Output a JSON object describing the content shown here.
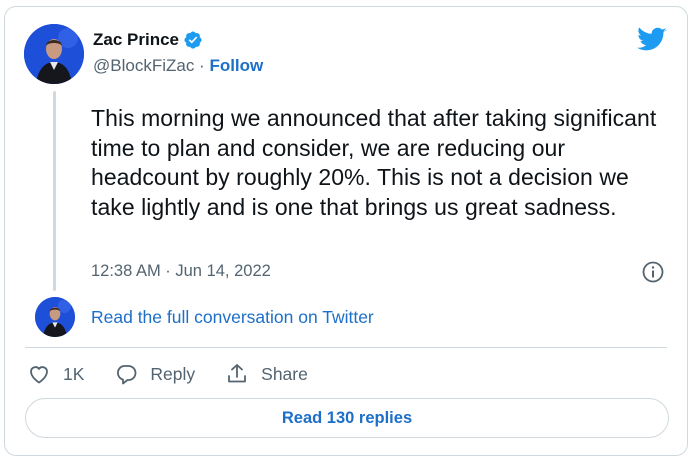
{
  "author": {
    "name": "Zac Prince",
    "handle": "@BlockFiZac",
    "separator": " · ",
    "follow_label": "Follow"
  },
  "tweet": {
    "text": "This morning we announced that after taking significant time to plan and consider, we are reducing our headcount by roughly 20%. This is not a decision we take lightly and is one that brings us great sadness.",
    "timestamp": "12:38 AM · Jun 14, 2022"
  },
  "conversation_link": "Read the full conversation on Twitter",
  "actions": {
    "like_count": "1K",
    "reply_label": "Reply",
    "share_label": "Share"
  },
  "replies_button": "Read 130 replies",
  "colors": {
    "accent": "#1d6fc9",
    "twitter_blue": "#1d9bf0",
    "muted": "#536471",
    "border": "#cfd9de"
  },
  "icons": [
    "verified-badge-icon",
    "twitter-bird-icon",
    "info-icon",
    "heart-icon",
    "reply-icon",
    "share-icon"
  ]
}
